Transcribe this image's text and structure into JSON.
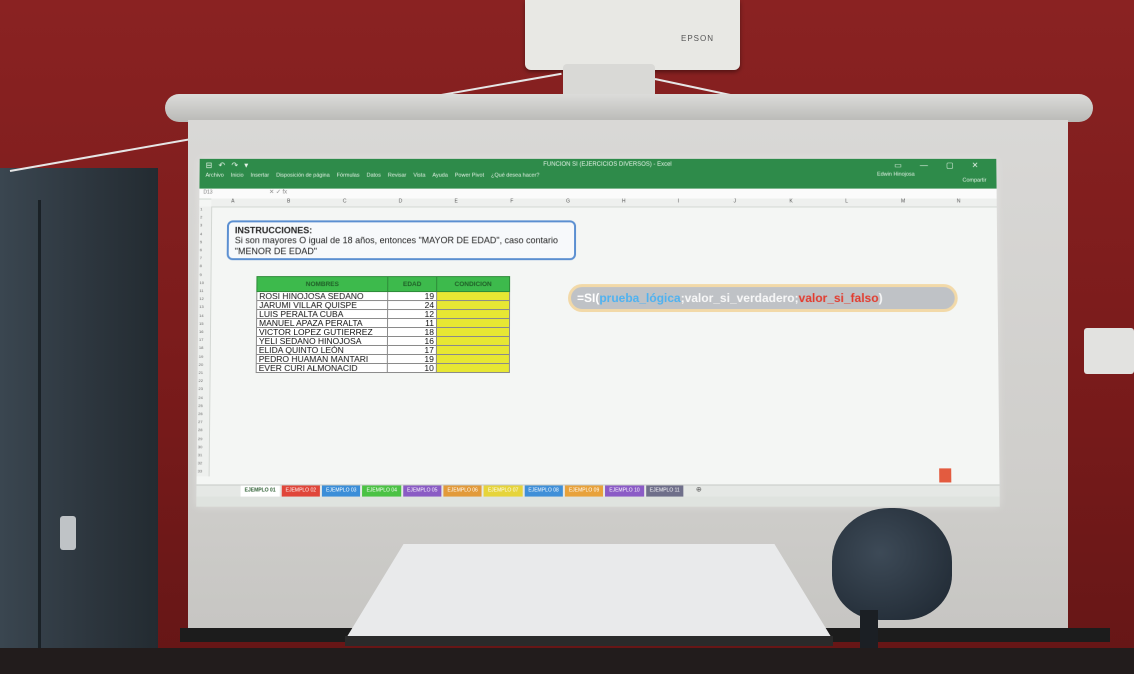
{
  "projector": {
    "brand": "EPSON"
  },
  "excel": {
    "title": "FUNCION SI (EJERCICIOS DIVERSOS) - Excel",
    "quick_access": "⊟ ↶ ↷ ▾",
    "window_controls": "▭ — ▢ ✕",
    "menu": [
      "Archivo",
      "Inicio",
      "Insertar",
      "Disposición de página",
      "Fórmulas",
      "Datos",
      "Revisar",
      "Vista",
      "Ayuda",
      "Power Pivot",
      "¿Qué desea hacer?"
    ],
    "user": "Edwin Hinojosa",
    "share": "Compartir",
    "namebox": "D13",
    "fx": "✕ ✓ fx",
    "columns": [
      "A",
      "B",
      "C",
      "D",
      "E",
      "F",
      "G",
      "H",
      "I",
      "J",
      "K",
      "L",
      "M",
      "N"
    ],
    "rows": [
      "1",
      "2",
      "3",
      "4",
      "5",
      "6",
      "7",
      "8",
      "9",
      "10",
      "11",
      "12",
      "13",
      "14",
      "15",
      "16",
      "17",
      "18",
      "19",
      "20",
      "21",
      "22",
      "23",
      "24",
      "25",
      "26",
      "27",
      "28",
      "29",
      "30",
      "31",
      "32",
      "33"
    ],
    "instructions": {
      "title": "INSTRUCCIONES:",
      "text": "Si son mayores O igual de 18 años, entonces \"MAYOR DE EDAD\", caso contario \"MENOR DE EDAD\""
    },
    "table": {
      "headers": [
        "NOMBRES",
        "EDAD",
        "CONDICION"
      ],
      "rows": [
        {
          "name": "ROSI HINOJOSA SEDANO",
          "age": "19"
        },
        {
          "name": "JARUMI VILLAR QUISPE",
          "age": "24"
        },
        {
          "name": "LUIS PERALTA CUBA",
          "age": "12"
        },
        {
          "name": "MANUEL APAZA PERALTA",
          "age": "11"
        },
        {
          "name": "VICTOR LOPEZ GUTIERREZ",
          "age": "18"
        },
        {
          "name": "YELI SEDANO HINOJOSA",
          "age": "16"
        },
        {
          "name": "ELIDA QUINTO LEÓN",
          "age": "17"
        },
        {
          "name": "PEDRO HUAMAN MANTARI",
          "age": "19"
        },
        {
          "name": "EVER CURI ALMONACID",
          "age": "10"
        }
      ]
    },
    "formula": {
      "eq": "=SI(",
      "arg1": "prueba_lógica",
      "sep1": ";",
      "arg2": "valor_si_verdadero",
      "sep2": ";",
      "arg3": "valor_si_falso",
      "close": ")"
    },
    "sheet_tabs": [
      {
        "label": "EJEMPLO 01",
        "color": "#ffffff",
        "active": true
      },
      {
        "label": "EJEMPLO 02",
        "color": "#e0463a"
      },
      {
        "label": "EJEMPLO 03",
        "color": "#3b8ed8"
      },
      {
        "label": "EJEMPLO 04",
        "color": "#4bc244"
      },
      {
        "label": "EJEMPLO 05",
        "color": "#8a5bc4"
      },
      {
        "label": "EJEMPLO 06",
        "color": "#e29a3a"
      },
      {
        "label": "EJEMPLO 07",
        "color": "#e6d43a"
      },
      {
        "label": "EJEMPLO 08",
        "color": "#3f8fd8"
      },
      {
        "label": "EJEMPLO 09",
        "color": "#e8a23b"
      },
      {
        "label": "EJEMPLO 10",
        "color": "#8b5bc6"
      },
      {
        "label": "EJEMPLO 11",
        "color": "#6f6f8a"
      }
    ],
    "tab_add": "⊕"
  }
}
